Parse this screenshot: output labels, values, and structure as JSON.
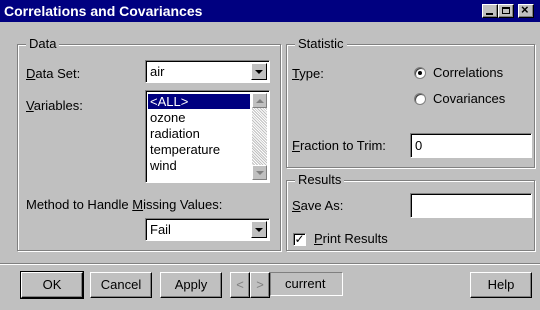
{
  "window": {
    "title": "Correlations and Covariances"
  },
  "data_group": {
    "legend": "Data",
    "dataset_label": {
      "underlined": "D",
      "rest": "ata Set:"
    },
    "dataset_value": "air",
    "variables_label": {
      "underlined": "V",
      "rest": "ariables:"
    },
    "variables": [
      "<ALL>",
      "ozone",
      "radiation",
      "temperature",
      "wind"
    ],
    "variables_selected_index": 0,
    "missing_label": {
      "before": "Method to Handle ",
      "underlined": "M",
      "rest": "issing Values:"
    },
    "missing_value": "Fail"
  },
  "statistic_group": {
    "legend": "Statistic",
    "type_label": {
      "underlined": "T",
      "rest": "ype:"
    },
    "options": [
      "Correlations",
      "Covariances"
    ],
    "selected_option": "Correlations",
    "trim_label": {
      "underlined": "F",
      "rest": "raction to Trim:"
    },
    "trim_value": "0"
  },
  "results_group": {
    "legend": "Results",
    "save_label": {
      "underlined": "S",
      "rest": "ave As:"
    },
    "save_value": "",
    "print_label": {
      "underlined": "P",
      "rest": "rint Results"
    },
    "print_checked": true
  },
  "buttons": {
    "ok": "OK",
    "cancel": "Cancel",
    "apply": "Apply",
    "prev": "<",
    "next": ">",
    "current": "current",
    "help": "Help"
  },
  "icons": {
    "minimize": "minimize-icon",
    "maximize": "maximize-icon",
    "close": "close-icon",
    "dropdown": "chevron-down-icon",
    "check": "✓"
  },
  "colors": {
    "titlebar": "#000080",
    "face": "#c0c0c0",
    "selection": "#000080"
  }
}
